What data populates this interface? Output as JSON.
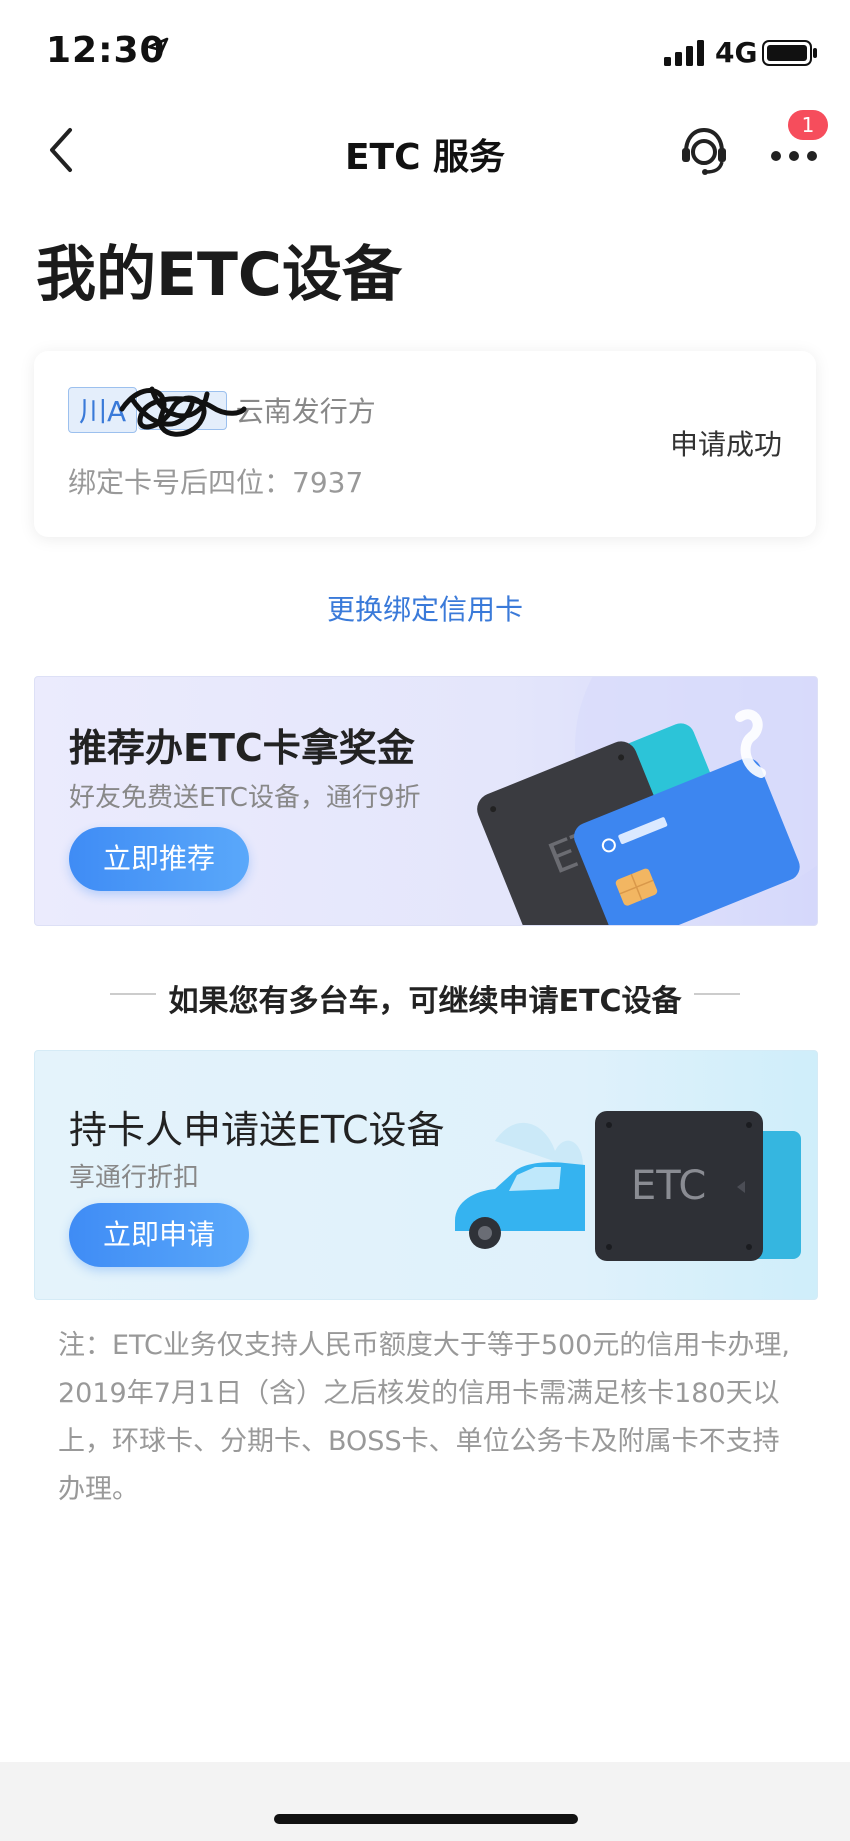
{
  "status_bar": {
    "time": "12:30",
    "network": "4G",
    "icons": [
      "location-arrow-icon",
      "signal-icon",
      "battery-icon"
    ]
  },
  "nav": {
    "title": "ETC 服务",
    "badge_count": "1",
    "icons": [
      "back-chevron-icon",
      "customer-service-icon",
      "more-dots-icon"
    ]
  },
  "page_title": "我的ETC设备",
  "device_card": {
    "plate": "川A",
    "issuer": "云南发行方",
    "card_last4": "绑定卡号后四位：7937",
    "status": "申请成功"
  },
  "change_card_link": "更换绑定信用卡",
  "banner_refer": {
    "title": "推荐办ETC卡拿奖金",
    "subtitle": "好友免费送ETC设备，通行9折",
    "button": "立即推荐",
    "device_label": "ETC"
  },
  "multi_car_title": "如果您有多台车，可继续申请ETC设备",
  "banner_apply": {
    "title": "持卡人申请送ETC设备",
    "subtitle": "享通行折扣",
    "button": "立即申请",
    "device_label": "ETC"
  },
  "note": "注：ETC业务仅支持人民币额度大于等于500元的信用卡办理, 2019年7月1日（含）之后核发的信用卡需满足核卡180天以上，环球卡、分期卡、BOSS卡、单位公务卡及附属卡不支持办理。",
  "colors": {
    "link_blue": "#3a7ad9",
    "button_blue": "#3f8cf5",
    "badge_red": "#f64d5c"
  }
}
